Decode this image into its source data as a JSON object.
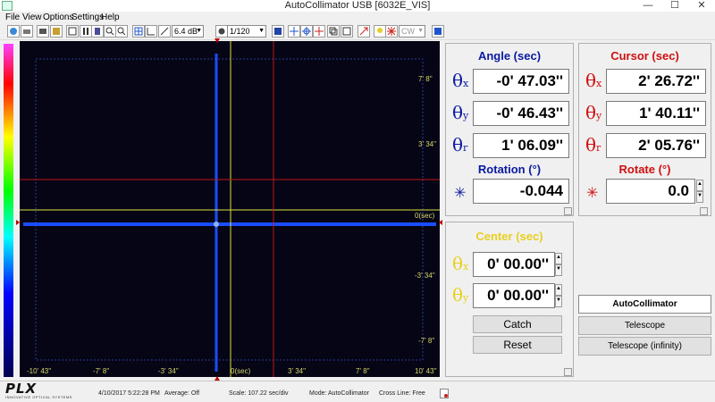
{
  "window": {
    "title": "AutoCollimator USB  [6032E_VIS]",
    "minimize": "—",
    "maximize": "☐",
    "close": "✕"
  },
  "menu": {
    "file": "File",
    "view": "View",
    "options": "Options",
    "settings": "Settings",
    "help": "Help"
  },
  "toolbar": {
    "gain": "6.4 dB",
    "rate": "1/120",
    "mode": "CW",
    "mode_disabled": true
  },
  "plot": {
    "y_ticks": [
      "7' 8''",
      "3' 34''",
      "0(sec)",
      "-3' 34''",
      "-7' 8''"
    ],
    "x_ticks": [
      "-10' 43''",
      "-7' 8''",
      "-3' 34''",
      "0(sec)",
      "3' 34''",
      "7' 8''",
      "10' 43''"
    ],
    "colors": {
      "background": "#050516",
      "beam": "#1a4dff",
      "center_lines": "#e0e040",
      "cursor_lines": "#c01818",
      "dashed_frame": "#2a3a9a"
    }
  },
  "angle": {
    "title": "Angle (sec)",
    "color": "#0a1aa0",
    "rows": [
      {
        "sym": "θ",
        "sub": "x",
        "value": "-0' 47.03''"
      },
      {
        "sym": "θ",
        "sub": "y",
        "value": "-0' 46.43''"
      },
      {
        "sym": "θ",
        "sub": "r",
        "value": "1' 06.09''"
      }
    ],
    "rotation_label": "Rotation (°)",
    "rotation_value": "-0.044"
  },
  "cursor": {
    "title": "Cursor (sec)",
    "color": "#d01010",
    "rows": [
      {
        "sym": "θ",
        "sub": "x",
        "value": "2' 26.72''"
      },
      {
        "sym": "θ",
        "sub": "y",
        "value": "1' 40.11''"
      },
      {
        "sym": "θ",
        "sub": "r",
        "value": "2' 05.76''"
      }
    ],
    "rotate_label": "Rotate (°)",
    "rotate_value": "0.0"
  },
  "center": {
    "title": "Center (sec)",
    "color": "#e8d020",
    "rows": [
      {
        "sym": "θ",
        "sub": "x",
        "value": "0' 00.00''"
      },
      {
        "sym": "θ",
        "sub": "y",
        "value": "0' 00.00''"
      }
    ],
    "catch": "Catch",
    "reset": "Reset"
  },
  "modes": {
    "autocollimator": "AutoCollimator",
    "telescope": "Telescope",
    "telescope_inf": "Telescope (infinity)",
    "selected": "autocollimator"
  },
  "status": {
    "datetime": "4/10/2017 5:22:28 PM",
    "average": "Average: Off",
    "scale": "Scale: 107.22 sec/div",
    "mode": "Mode: AutoCollimator",
    "crossline": "Cross Line: Free"
  },
  "logo": {
    "text": "PLX",
    "tagline": "INNOVATIVE OPTICAL SYSTEMS"
  }
}
